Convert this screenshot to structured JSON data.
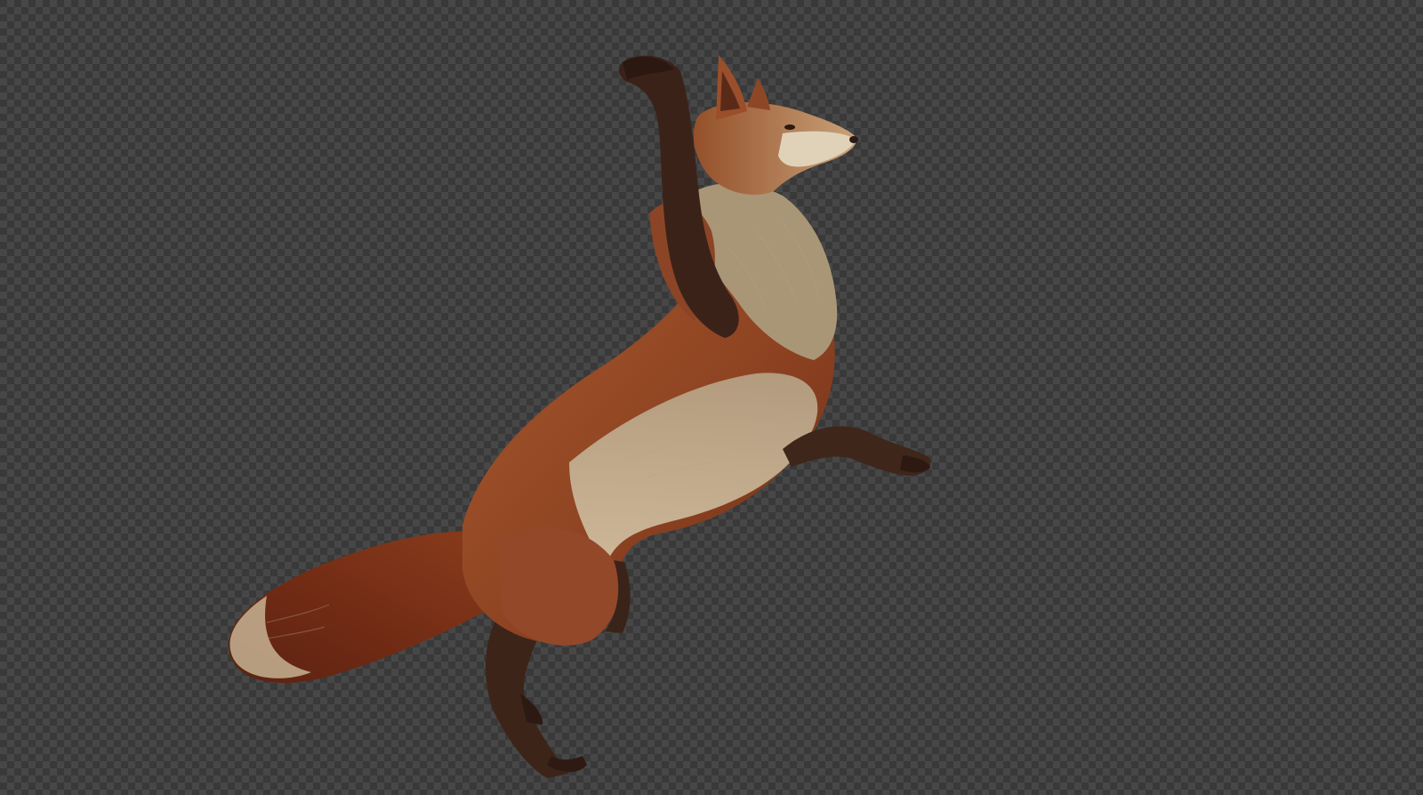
{
  "scene": {
    "subject_icon": "fox-figure-icon",
    "colors": {
      "checker_dark": "#393939",
      "checker_light": "#474747",
      "fur_red": "#9a4a22",
      "fur_dark_red": "#6e2f16",
      "fur_cream": "#cdbb9c",
      "leg_dark": "#3a2218",
      "tail_tip": "#c9b89a"
    }
  }
}
